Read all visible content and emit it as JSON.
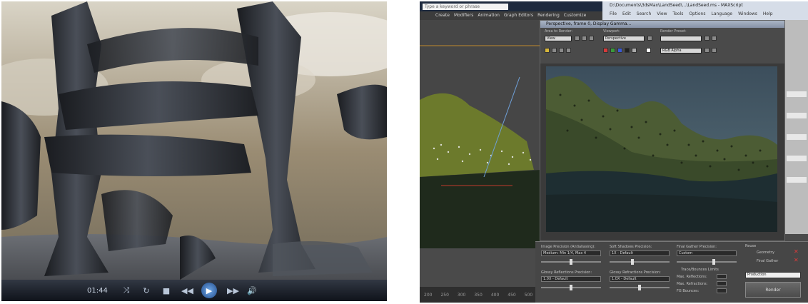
{
  "player": {
    "time": "01:44",
    "controls": [
      "⤨",
      "↻",
      "■",
      "◀◀",
      "▶",
      "▶▶",
      "🔊"
    ]
  },
  "max": {
    "keyword_placeholder": "Type a keyword or phrase",
    "menu": [
      "Create",
      "Modifiers",
      "Animation",
      "Graph Editors",
      "Rendering",
      "Customize"
    ],
    "script_title": "D:\\Documents\\3dsMax\\LandSeed\\...\\LandSeed.ms - MAXScript",
    "script_menu": [
      "File",
      "Edit",
      "Search",
      "View",
      "Tools",
      "Options",
      "Language",
      "Windows",
      "Help"
    ],
    "ruler": [
      "200",
      "250",
      "300",
      "350",
      "400",
      "450",
      "500"
    ],
    "render_frame": {
      "title": "Perspective, frame 0, Display Gamma...",
      "area_to_render_label": "Area to Render:",
      "area_to_render_value": "View",
      "viewport_label": "Viewport:",
      "viewport_value": "Perspective",
      "render_preset_label": "Render Preset:",
      "render_preset_value": "",
      "channel_value": "RGB Alpha"
    },
    "settings": {
      "image_precision_label": "Image Precision (Antialiasing):",
      "image_precision_value": "Medium: Min 1/4, Max 4",
      "soft_shadows_label": "Soft Shadows Precision:",
      "soft_shadows_value": "1X - Default",
      "final_gather_label": "Final Gather Precision:",
      "final_gather_value": "Custom",
      "reuse_label": "Reuse",
      "geometry_label": "Geometry",
      "final_gather_item": "Final Gather",
      "glossy_refl_label": "Glossy Reflections Precision:",
      "glossy_refl_value": "1.0X - Default",
      "glossy_refr_label": "Glossy Refractions Precision:",
      "glossy_refr_value": "1.0X - Default",
      "trace_label": "Trace/Bounces Limits",
      "max_reflections_label": "Max. Reflections:",
      "max_refractions_label": "Max. Refractions:",
      "fg_bounces_label": "FG Bounces:",
      "preset_value": "Production",
      "render_label": "Render"
    }
  }
}
